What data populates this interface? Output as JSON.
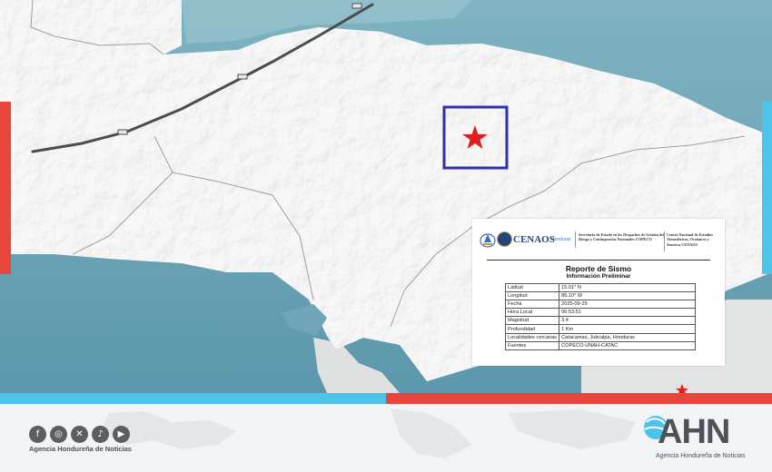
{
  "report": {
    "cenaos_name": "CENAOS",
    "cenaos_country": "Honduras",
    "secretaria_text": "Secretaría de Estado en los Despachos de Gestión del Riesgo y Contingencias Nacionales COPECO",
    "centro_text": "Centro Nacional de Estudios Atmosféricos, Oceánicos y Sísmicos CENAOS",
    "title": "Reporte de Sismo",
    "subtitle": "Información Preliminar",
    "rows": [
      {
        "key": "Latitud",
        "value": "15.01° N"
      },
      {
        "key": "Longitud",
        "value": "86.10° W"
      },
      {
        "key": "Fecha",
        "value": "2025-09-25"
      },
      {
        "key": "Hora Local",
        "value": "06:53:51"
      },
      {
        "key": "Magnitud",
        "value": "3.4"
      },
      {
        "key": "Profundidad",
        "value": "1 Km"
      },
      {
        "key": "Localidades cercanas",
        "value": "Catacamas, Juticalpa, Honduras"
      },
      {
        "key": "Fuentes",
        "value": "COPECO-UNAH-CATAC"
      }
    ]
  },
  "footer": {
    "social_icons": [
      "facebook-icon",
      "instagram-icon",
      "x-icon",
      "tiktok-icon",
      "youtube-icon"
    ],
    "agency_small": "Agencia Hondureña de Noticias",
    "logo_text": "AHN",
    "logo_subtitle": "Agencia Hondureña de Noticias"
  },
  "colors": {
    "accent_red": "#e8453c",
    "accent_blue": "#4ec3ea",
    "epicenter_box": "#2f2fb0",
    "epicenter_star": "#e02020"
  }
}
